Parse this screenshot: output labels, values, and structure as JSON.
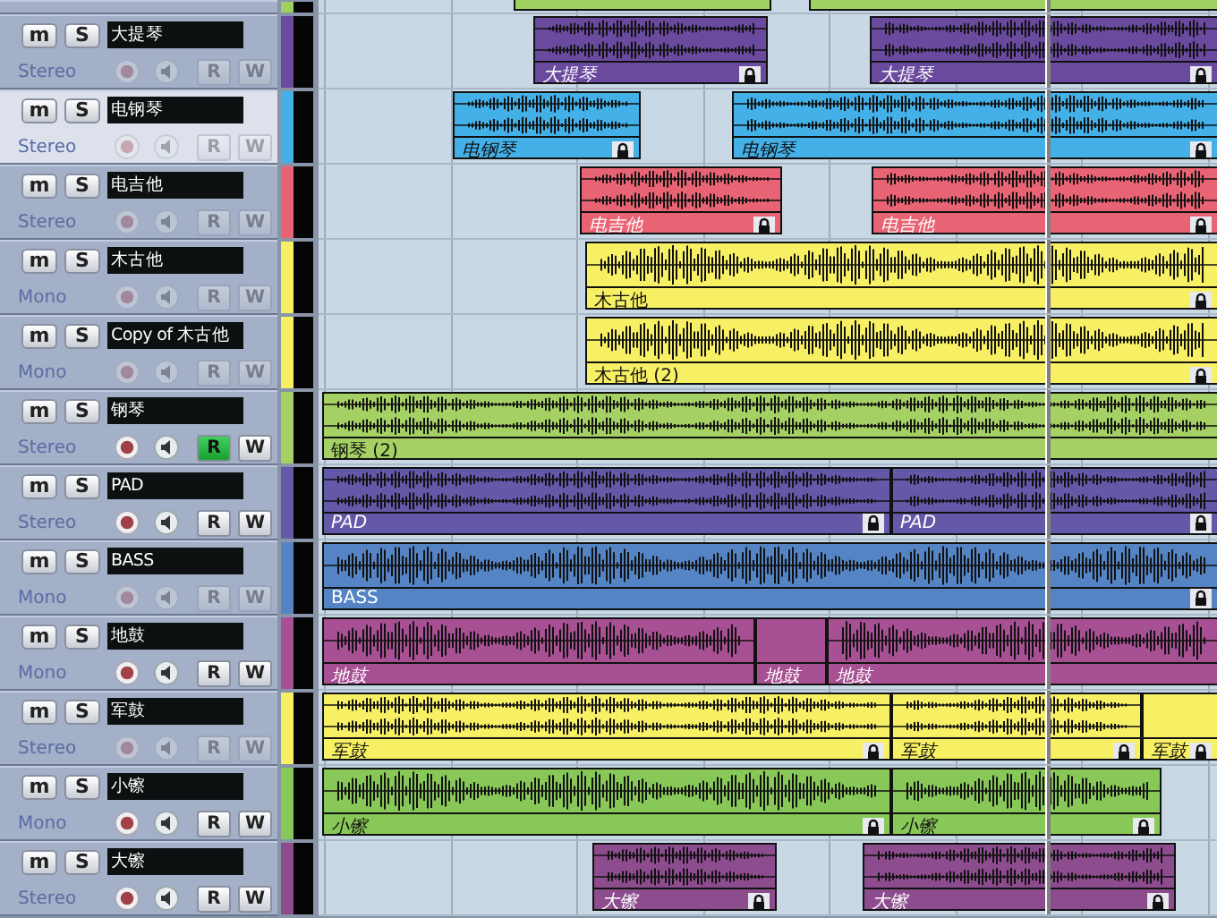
{
  "top_partial_track": {
    "color": "#a0d060"
  },
  "tracks": [
    {
      "name": "大提琴",
      "channel": "Stereo",
      "color": "#6a4a9e",
      "selected": false,
      "disabled": true,
      "read_on": false,
      "mute": "m",
      "solo": "S",
      "read": "R",
      "write": "W",
      "clip_label_italic": true,
      "clips": [
        {
          "label": "大提琴",
          "locked": true
        },
        {
          "label": "大提琴",
          "locked": true
        }
      ]
    },
    {
      "name": "电钢琴",
      "channel": "Stereo",
      "color": "#44b0e8",
      "selected": true,
      "disabled": true,
      "read_on": false,
      "mute": "m",
      "solo": "S",
      "read": "R",
      "write": "W",
      "clip_label_italic": true,
      "clips": [
        {
          "label": "电钢琴",
          "locked": true
        },
        {
          "label": "电钢琴",
          "locked": true
        }
      ]
    },
    {
      "name": "电吉他",
      "channel": "Stereo",
      "color": "#e86474",
      "selected": false,
      "disabled": true,
      "read_on": false,
      "mute": "m",
      "solo": "S",
      "read": "R",
      "write": "W",
      "clip_label_italic": true,
      "clips": [
        {
          "label": "电吉他",
          "locked": true
        },
        {
          "label": "电吉他",
          "locked": true
        }
      ]
    },
    {
      "name": "木古他",
      "channel": "Mono",
      "color": "#f8f064",
      "selected": false,
      "disabled": true,
      "read_on": false,
      "mute": "m",
      "solo": "S",
      "read": "R",
      "write": "W",
      "clip_label_italic": false,
      "clips": [
        {
          "label": "木古他",
          "locked": true
        }
      ]
    },
    {
      "name": "Copy of 木古他",
      "channel": "Mono",
      "color": "#f8f064",
      "selected": false,
      "disabled": true,
      "read_on": false,
      "mute": "m",
      "solo": "S",
      "read": "R",
      "write": "W",
      "clip_label_italic": false,
      "clips": [
        {
          "label": "木古他 (2)",
          "locked": true
        }
      ]
    },
    {
      "name": "钢琴",
      "channel": "Stereo",
      "color": "#a4d064",
      "selected": false,
      "disabled": false,
      "read_on": true,
      "mute": "m",
      "solo": "S",
      "read": "R",
      "write": "W",
      "clip_label_italic": false,
      "clips": [
        {
          "label": "钢琴 (2)",
          "locked": false
        }
      ]
    },
    {
      "name": "PAD",
      "channel": "Stereo",
      "color": "#6458a8",
      "selected": false,
      "disabled": false,
      "read_on": false,
      "mute": "m",
      "solo": "S",
      "read": "R",
      "write": "W",
      "clip_label_italic": true,
      "clips": [
        {
          "label": "PAD",
          "locked": true
        },
        {
          "label": "PAD",
          "locked": true
        }
      ]
    },
    {
      "name": "BASS",
      "channel": "Mono",
      "color": "#5484c4",
      "selected": false,
      "disabled": true,
      "read_on": false,
      "mute": "m",
      "solo": "S",
      "read": "R",
      "write": "W",
      "clip_label_italic": false,
      "clips": [
        {
          "label": "BASS",
          "locked": true
        }
      ]
    },
    {
      "name": "地鼓",
      "channel": "Mono",
      "color": "#a85094",
      "selected": false,
      "disabled": false,
      "read_on": false,
      "mute": "m",
      "solo": "S",
      "read": "R",
      "write": "W",
      "clip_label_italic": true,
      "clips": [
        {
          "label": "地鼓",
          "locked": false
        },
        {
          "label": "地鼓",
          "locked": false
        },
        {
          "label": "地鼓",
          "locked": false
        }
      ]
    },
    {
      "name": "军鼓",
      "channel": "Stereo",
      "color": "#f8f064",
      "selected": false,
      "disabled": true,
      "read_on": false,
      "mute": "m",
      "solo": "S",
      "read": "R",
      "write": "W",
      "clip_label_italic": true,
      "clips": [
        {
          "label": "军鼓",
          "locked": true
        },
        {
          "label": "军鼓",
          "locked": true
        },
        {
          "label": "军鼓",
          "locked": true
        }
      ]
    },
    {
      "name": "小镲",
      "channel": "Mono",
      "color": "#88c858",
      "selected": false,
      "disabled": false,
      "read_on": false,
      "mute": "m",
      "solo": "S",
      "read": "R",
      "write": "W",
      "clip_label_italic": true,
      "clips": [
        {
          "label": "小镲",
          "locked": true
        },
        {
          "label": "小镲",
          "locked": true
        }
      ]
    },
    {
      "name": "大镲",
      "channel": "Stereo",
      "color": "#8c4c8e",
      "selected": false,
      "disabled": false,
      "read_on": false,
      "mute": "m",
      "solo": "S",
      "read": "R",
      "write": "W",
      "clip_label_italic": true,
      "clips": [
        {
          "label": "大镲",
          "locked": true
        },
        {
          "label": "大镲",
          "locked": true
        }
      ]
    }
  ]
}
